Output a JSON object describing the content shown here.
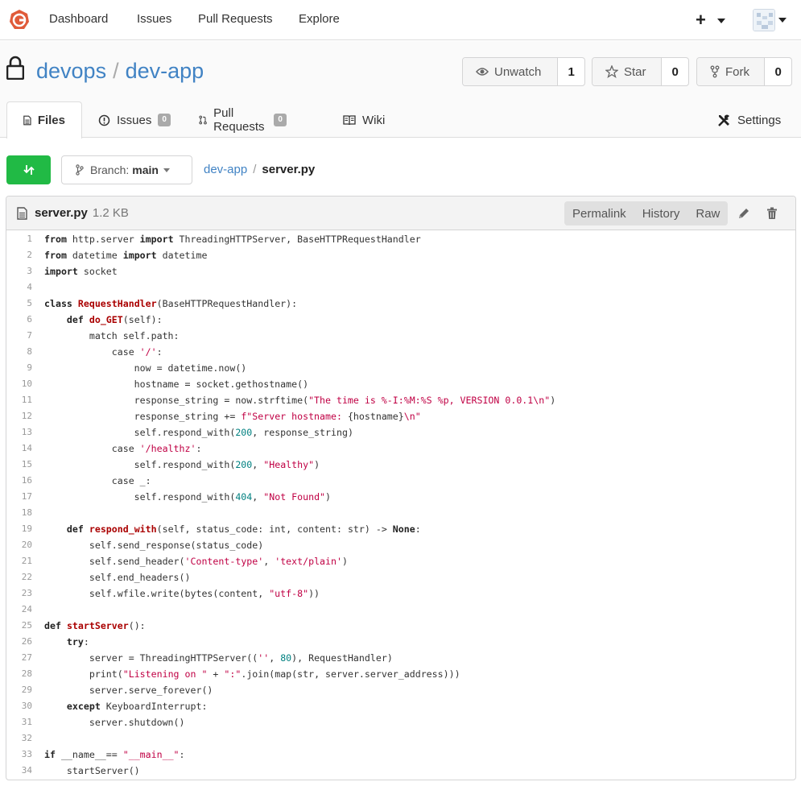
{
  "nav": {
    "items": [
      "Dashboard",
      "Issues",
      "Pull Requests",
      "Explore"
    ],
    "plus": "+"
  },
  "repo": {
    "owner": "devops",
    "separator": "/",
    "name": "dev-app",
    "watch": {
      "label": "Unwatch",
      "count": "1"
    },
    "star": {
      "label": "Star",
      "count": "0"
    },
    "fork": {
      "label": "Fork",
      "count": "0"
    }
  },
  "tabs": {
    "files": "Files",
    "issues": {
      "label": "Issues",
      "count": "0"
    },
    "pulls": {
      "label": "Pull Requests",
      "count": "0"
    },
    "wiki": "Wiki",
    "settings": "Settings"
  },
  "branch": {
    "prefix": "Branch:",
    "name": "main"
  },
  "path": {
    "repo": "dev-app",
    "separator": "/",
    "file": "server.py"
  },
  "file": {
    "name": "server.py",
    "size": "1.2 KB",
    "actions": [
      "Permalink",
      "History",
      "Raw"
    ]
  },
  "code_lines": [
    [
      [
        "kw",
        "from"
      ],
      [
        "t",
        " http.server "
      ],
      [
        "kw",
        "import"
      ],
      [
        "t",
        " ThreadingHTTPServer, BaseHTTPRequestHandler"
      ]
    ],
    [
      [
        "kw",
        "from"
      ],
      [
        "t",
        " datetime "
      ],
      [
        "kw",
        "import"
      ],
      [
        "t",
        " datetime"
      ]
    ],
    [
      [
        "kw",
        "import"
      ],
      [
        "t",
        " socket"
      ]
    ],
    [],
    [
      [
        "kw",
        "class"
      ],
      [
        "t",
        " "
      ],
      [
        "fn",
        "RequestHandler"
      ],
      [
        "t",
        "(BaseHTTPRequestHandler):"
      ]
    ],
    [
      [
        "t",
        "    "
      ],
      [
        "kw",
        "def"
      ],
      [
        "t",
        " "
      ],
      [
        "fn",
        "do_GET"
      ],
      [
        "t",
        "(self):"
      ]
    ],
    [
      [
        "t",
        "        match self.path:"
      ]
    ],
    [
      [
        "t",
        "            case "
      ],
      [
        "str",
        "'/'"
      ],
      [
        "t",
        ":"
      ]
    ],
    [
      [
        "t",
        "                now = datetime.now()"
      ]
    ],
    [
      [
        "t",
        "                hostname = socket.gethostname()"
      ]
    ],
    [
      [
        "t",
        "                response_string = now.strftime("
      ],
      [
        "str",
        "\"The time is %-I:%M:%S %p, VERSION 0.0.1\\n\""
      ],
      [
        "t",
        ")"
      ]
    ],
    [
      [
        "t",
        "                response_string += "
      ],
      [
        "str",
        "f\"Server hostname: "
      ],
      [
        "t",
        "{hostname}"
      ],
      [
        "str",
        "\\n\""
      ]
    ],
    [
      [
        "t",
        "                self.respond_with("
      ],
      [
        "num",
        "200"
      ],
      [
        "t",
        ", response_string)"
      ]
    ],
    [
      [
        "t",
        "            case "
      ],
      [
        "str",
        "'/healthz'"
      ],
      [
        "t",
        ":"
      ]
    ],
    [
      [
        "t",
        "                self.respond_with("
      ],
      [
        "num",
        "200"
      ],
      [
        "t",
        ", "
      ],
      [
        "str",
        "\"Healthy\""
      ],
      [
        "t",
        ")"
      ]
    ],
    [
      [
        "t",
        "            case _:"
      ]
    ],
    [
      [
        "t",
        "                self.respond_with("
      ],
      [
        "num",
        "404"
      ],
      [
        "t",
        ", "
      ],
      [
        "str",
        "\"Not Found\""
      ],
      [
        "t",
        ")"
      ]
    ],
    [],
    [
      [
        "t",
        "    "
      ],
      [
        "kw",
        "def"
      ],
      [
        "t",
        " "
      ],
      [
        "fn",
        "respond_with"
      ],
      [
        "t",
        "(self, status_code: int, content: str) -> "
      ],
      [
        "kw",
        "None"
      ],
      [
        "t",
        ":"
      ]
    ],
    [
      [
        "t",
        "        self.send_response(status_code)"
      ]
    ],
    [
      [
        "t",
        "        self.send_header("
      ],
      [
        "str",
        "'Content-type'"
      ],
      [
        "t",
        ", "
      ],
      [
        "str",
        "'text/plain'"
      ],
      [
        "t",
        ")"
      ]
    ],
    [
      [
        "t",
        "        self.end_headers()"
      ]
    ],
    [
      [
        "t",
        "        self.wfile.write(bytes(content, "
      ],
      [
        "str",
        "\"utf-8\""
      ],
      [
        "t",
        "))"
      ]
    ],
    [],
    [
      [
        "kw",
        "def"
      ],
      [
        "t",
        " "
      ],
      [
        "fn",
        "startServer"
      ],
      [
        "t",
        "():"
      ]
    ],
    [
      [
        "t",
        "    "
      ],
      [
        "kw",
        "try"
      ],
      [
        "t",
        ":"
      ]
    ],
    [
      [
        "t",
        "        server = ThreadingHTTPServer(("
      ],
      [
        "str",
        "''"
      ],
      [
        "t",
        ", "
      ],
      [
        "num",
        "80"
      ],
      [
        "t",
        "), RequestHandler)"
      ]
    ],
    [
      [
        "t",
        "        print("
      ],
      [
        "str",
        "\"Listening on \""
      ],
      [
        "t",
        " + "
      ],
      [
        "str",
        "\":\""
      ],
      [
        "t",
        ".join(map(str, server.server_address)))"
      ]
    ],
    [
      [
        "t",
        "        server.serve_forever()"
      ]
    ],
    [
      [
        "t",
        "    "
      ],
      [
        "kw",
        "except"
      ],
      [
        "t",
        " KeyboardInterrupt:"
      ]
    ],
    [
      [
        "t",
        "        server.shutdown()"
      ]
    ],
    [],
    [
      [
        "kw",
        "if"
      ],
      [
        "t",
        " __name__== "
      ],
      [
        "str",
        "\"__main__\""
      ],
      [
        "t",
        ":"
      ]
    ],
    [
      [
        "t",
        "    startServer()"
      ]
    ]
  ],
  "colors": {
    "link": "#4183c4",
    "green": "#21ba45",
    "logo": "#e05b3a",
    "string": "#c00044",
    "number": "#008080",
    "function": "#aa0000"
  }
}
